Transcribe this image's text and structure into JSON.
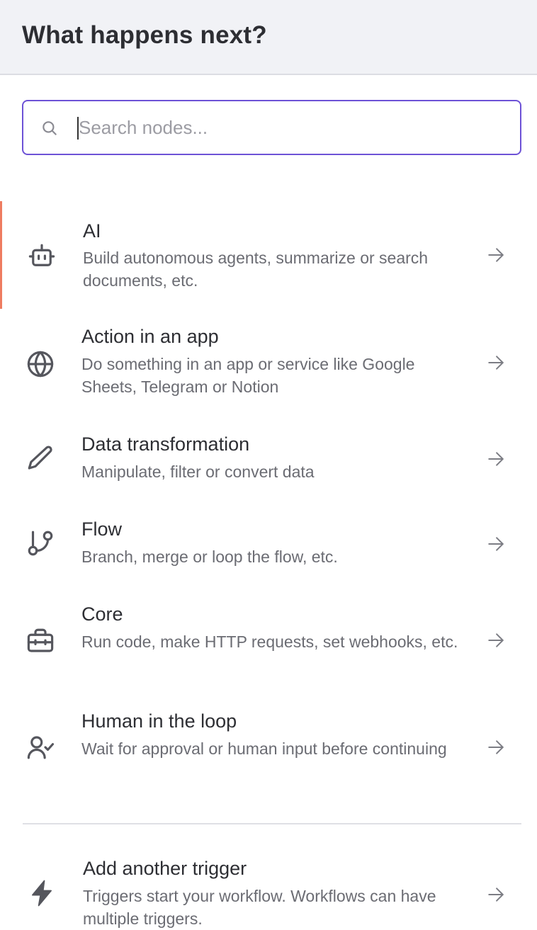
{
  "header": {
    "title": "What happens next?"
  },
  "search": {
    "placeholder": "Search nodes...",
    "value": ""
  },
  "items": [
    {
      "title": "AI",
      "description": "Build autonomous agents, summarize or search documents, etc.",
      "icon": "robot-icon",
      "active": true
    },
    {
      "title": "Action in an app",
      "description": "Do something in an app or service like Google Sheets, Telegram or Notion",
      "icon": "globe-icon"
    },
    {
      "title": "Data transformation",
      "description": "Manipulate, filter or convert data",
      "icon": "pencil-icon"
    },
    {
      "title": "Flow",
      "description": "Branch, merge or loop the flow, etc.",
      "icon": "git-branch-icon"
    },
    {
      "title": "Core",
      "description": "Run code, make HTTP requests, set webhooks, etc.",
      "icon": "toolbox-icon"
    },
    {
      "title": "Human in the loop",
      "description": "Wait for approval or human input before continuing",
      "icon": "user-check-icon"
    }
  ],
  "trigger": {
    "title": "Add another trigger",
    "description": "Triggers start your workflow. Workflows can have multiple triggers.",
    "icon": "lightning-icon"
  },
  "colors": {
    "accent": "#6d52d6",
    "active_indicator": "#ee7c60",
    "header_bg": "#f1f2f6"
  }
}
